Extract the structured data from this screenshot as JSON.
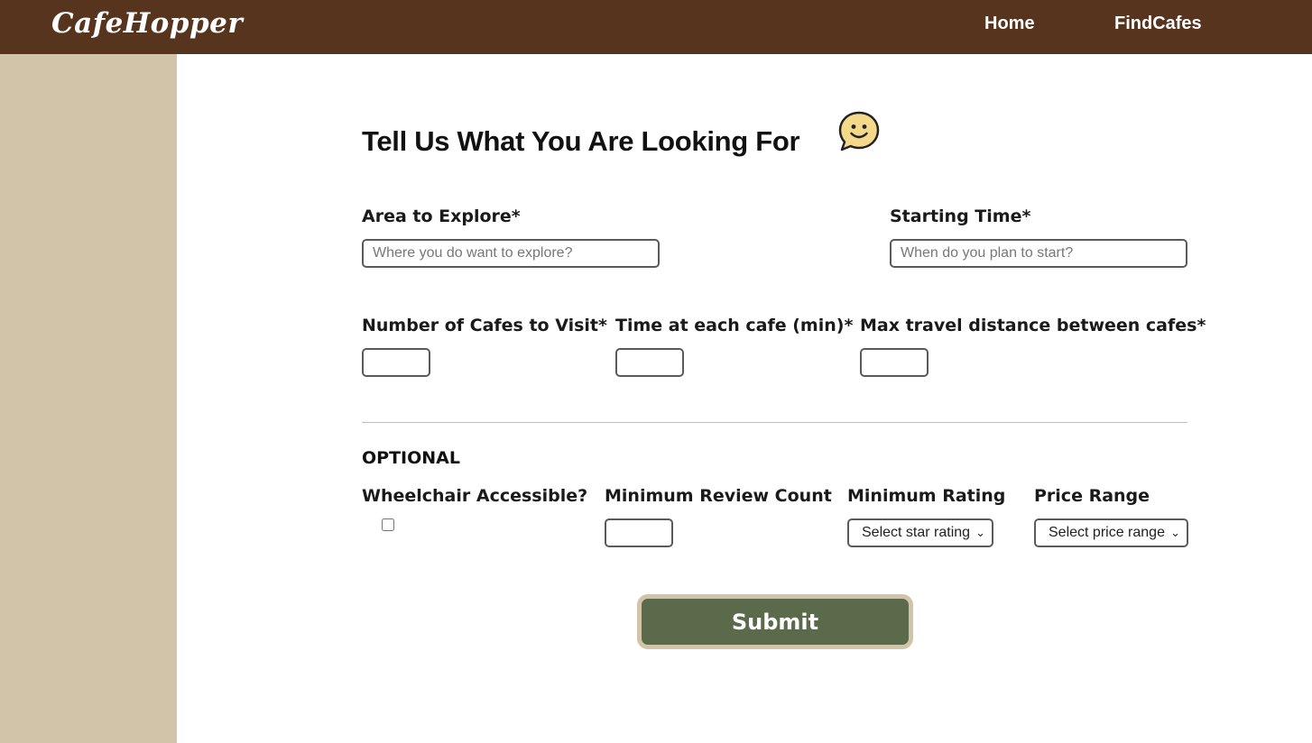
{
  "nav": {
    "logo": "CafeHopper",
    "links": [
      "Home",
      "FindCafes"
    ]
  },
  "form": {
    "title": "Tell Us What You Are Looking For",
    "area": {
      "label": "Area to Explore*",
      "placeholder": "Where you do want to explore?",
      "value": ""
    },
    "start_time": {
      "label": "Starting Time*",
      "placeholder": "When do you plan to start?",
      "value": ""
    },
    "num_cafes": {
      "label": "Number of Cafes to Visit*",
      "value": ""
    },
    "time_each": {
      "label": "Time at each cafe (min)*",
      "value": ""
    },
    "max_distance": {
      "label": "Max travel distance between cafes*",
      "value": ""
    },
    "optional": {
      "heading": "OPTIONAL",
      "wheelchair": {
        "label": "Wheelchair Accessible?",
        "checked": false
      },
      "min_reviews": {
        "label": "Minimum Review Count",
        "value": ""
      },
      "min_rating": {
        "label": "Minimum Rating",
        "selected": "Select star rating"
      },
      "price_range": {
        "label": "Price Range",
        "selected": "Select price range"
      }
    },
    "submit_label": "Submit"
  },
  "colors": {
    "navbar": "#57341d",
    "sidebar": "#d1c4a8",
    "submit": "#5a6a4b",
    "submit_border": "#d1c4a8",
    "smiley_fill": "#f5d98a"
  },
  "icons": {
    "smiley": "smiley-chat-icon",
    "select_arrow": "chevron-down-icon"
  }
}
